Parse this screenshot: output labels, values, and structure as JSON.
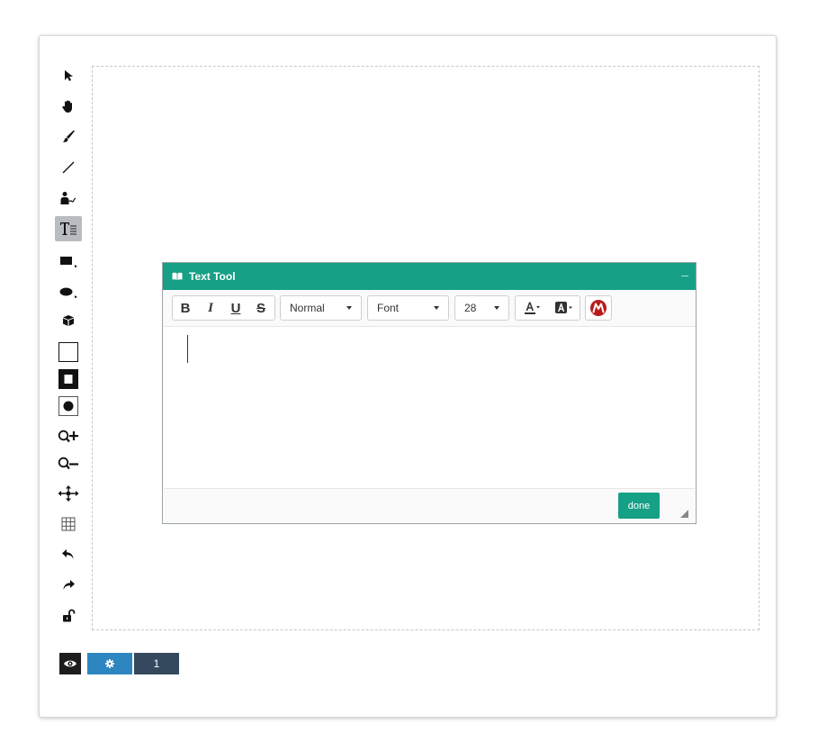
{
  "toolbar": {
    "tools": [
      {
        "icon": "arrow-pointer-icon"
      },
      {
        "icon": "hand-icon"
      },
      {
        "icon": "paintbrush-icon"
      },
      {
        "icon": "line-icon"
      },
      {
        "icon": "signature-icon"
      },
      {
        "icon": "text-tool-icon",
        "active": true
      },
      {
        "icon": "rectangle-icon"
      },
      {
        "icon": "ellipse-icon"
      },
      {
        "icon": "cube-icon"
      },
      {
        "icon": "stroke-square-icon"
      },
      {
        "icon": "fill-square-icon"
      },
      {
        "icon": "brush-size-icon"
      },
      {
        "icon": "zoom-in-icon"
      },
      {
        "icon": "zoom-out-icon"
      },
      {
        "icon": "move-arrows-icon"
      },
      {
        "icon": "grid-icon"
      },
      {
        "icon": "undo-icon"
      },
      {
        "icon": "redo-icon"
      },
      {
        "icon": "unlock-icon"
      }
    ],
    "active_color": "#b9bcc0"
  },
  "bottom_bar": {
    "eye_icon": "eye-icon",
    "gear_icon": "gear-icon",
    "page_number": "1"
  },
  "text_dialog": {
    "title": "Text Tool",
    "title_icon": "book-open-icon",
    "header_color": "#16a085",
    "format_buttons": [
      "B",
      "I",
      "U",
      "S"
    ],
    "paragraph_select": "Normal",
    "font_select": "Font",
    "size_select": "28",
    "text_color_icon": "font-color-icon",
    "bg_color_icon": "font-background-icon",
    "math_icon": "math-symbol-icon",
    "editor_text": "",
    "done_label": "done"
  }
}
